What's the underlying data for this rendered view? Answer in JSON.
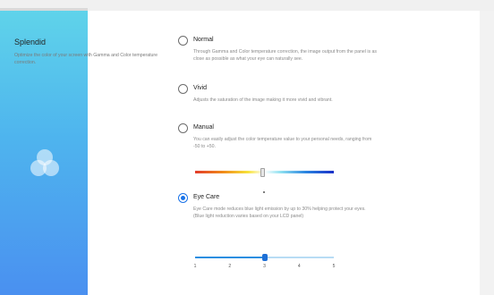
{
  "app": {
    "accent_color": "#1a73e8"
  },
  "logo": {
    "icon": "circles-logo-icon"
  },
  "section": {
    "title": "Splendid",
    "description": "Optimize the color of your screen with Gamma and Color temperature correction."
  },
  "options": [
    {
      "label": "Normal",
      "description": "Through Gamma and Color temperature correction, the image output from the panel is as close as possible as what your eye can naturally see.",
      "selected": false
    },
    {
      "label": "Vivid",
      "description": "Adjusts the saturation of the image making it more vivid and vibrant.",
      "selected": false
    },
    {
      "label": "Manual",
      "description": "You can easily adjust the color temperature value to your personal needs, ranging from -50 to +50.",
      "selected": false
    },
    {
      "label": "Eye Care",
      "description": "Eye Care mode reduces blue light emission by up to 30% helping protect your eyes. (Blue light reduction varies based on your LCD panel)",
      "selected": true
    }
  ],
  "manual_slider": {
    "min": -50,
    "max": 50,
    "value": 0
  },
  "eyecare_slider": {
    "ticks": [
      "1",
      "2",
      "3",
      "4",
      "5"
    ],
    "value": 3
  }
}
